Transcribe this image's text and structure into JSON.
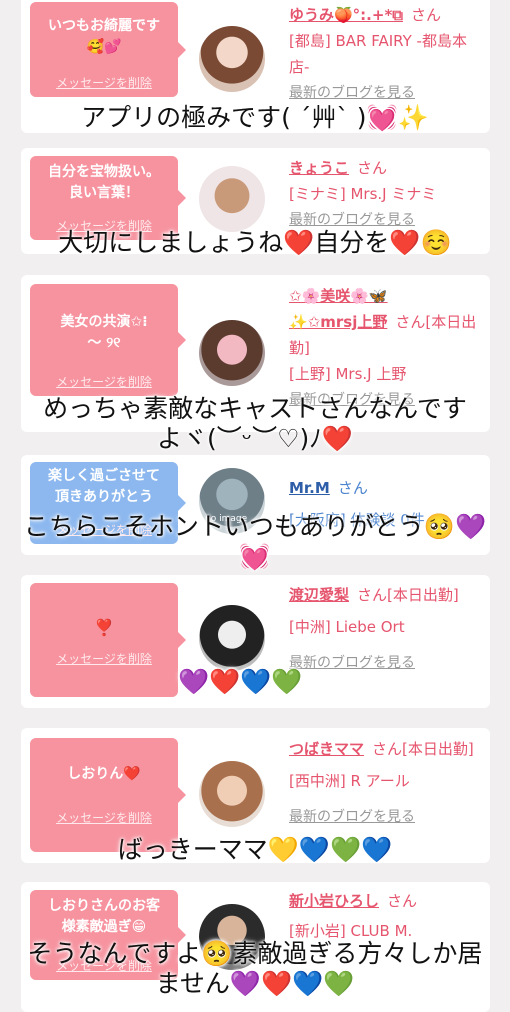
{
  "cards": [
    {
      "message": "いつもお綺麗です\n🥰💕",
      "delete": "メッセージを削除",
      "name": "ゆうみ🍑°:.+*⧉",
      "san": "さん",
      "shop": "[都島] BAR FAIRY -都島本店-",
      "blog": "最新のブログを見る"
    },
    {
      "message": "自分を宝物扱い。\n良い言葉！",
      "delete": "メッセージを削除",
      "name": "きょうこ",
      "san": "さん",
      "shop": "[ミナミ] Mrs.J ミナミ",
      "blog": "最新のブログを見る"
    },
    {
      "message": "美女の共演✩⁝\n〜 ୨୧",
      "delete": "メッセージを削除",
      "name": "✩🌸美咲🌸🦋",
      "name2": "✨✩mrsj上野",
      "san": "さん[本日出勤]",
      "shop": "[上野] Mrs.J 上野",
      "blog": "最新のブログを見る"
    },
    {
      "message": "楽しく過ごさせて\n頂きありがとう",
      "delete": "メッセージを削除",
      "name": "Mr.M",
      "san": "さん",
      "shop": "[大阪府] 体験談 0件",
      "blog": ""
    },
    {
      "message": "❣️",
      "delete": "メッセージを削除",
      "name": "渡辺愛梨",
      "san": "さん[本日出勤]",
      "shop": "[中洲] Liebe Ort",
      "blog": "最新のブログを見る"
    },
    {
      "message": "しおりん❤️",
      "delete": "メッセージを削除",
      "name": "つばきママ",
      "san": "さん[本日出勤]",
      "shop": "[西中洲] R アール",
      "blog": "最新のブログを見る"
    },
    {
      "message": "しおりさんのお客\n様素敵過ぎ😁",
      "delete": "メッセージを削除",
      "name": "新小岩ひろし",
      "san": "さん",
      "shop": "[新小岩] CLUB M.",
      "blog": ""
    }
  ],
  "overlays": {
    "o1": "アプリの極みです( ˊ艸ˋ )💓✨",
    "o2": "大切にしましょうね❤️自分を❤️☺️",
    "o3": "めっちゃ素敵なキャストさんなんです\nよヾ(︶ᵕ︶♡)ﾉ❤️",
    "o4": "こちらこそホントいつもありがとう🥺💜\n💓",
    "o5": "💜❤️💙💚",
    "o6": "ばっきーママ💛💙💚💙",
    "o7": "そうなんですよ🥺素敵過ぎる方々しか居\nません💜❤️💙💚"
  },
  "avatar_badge": "no image",
  "colors": {
    "pink": "#f6939f",
    "blue": "#8cb8ef",
    "name_pink": "#e6556e",
    "name_blue": "#2e5ea8"
  }
}
